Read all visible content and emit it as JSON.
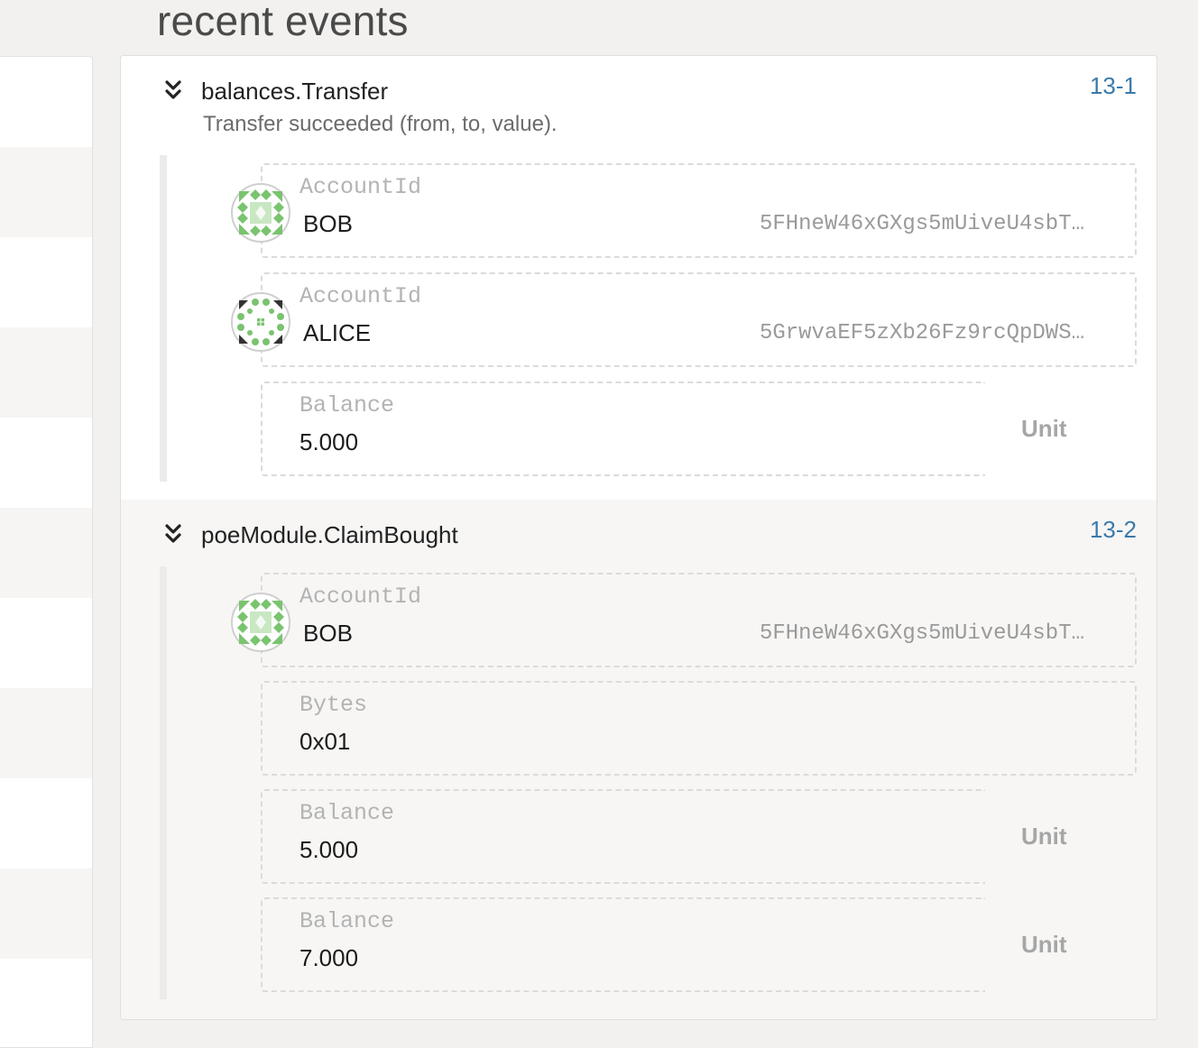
{
  "section": {
    "title": "recent events"
  },
  "events": [
    {
      "method": "balances.Transfer",
      "description": "Transfer succeeded (from, to, value).",
      "id": "13-1",
      "params": [
        {
          "type": "AccountId",
          "name": "BOB",
          "address": "5FHneW46xGXgs5mUiveU4sbT…",
          "icon": "bob-identicon"
        },
        {
          "type": "AccountId",
          "name": "ALICE",
          "address": "5GrwvaEF5zXb26Fz9rcQpDWS…",
          "icon": "alice-identicon"
        },
        {
          "type": "Balance",
          "value": "5.000",
          "unit": "Unit"
        }
      ]
    },
    {
      "method": "poeModule.ClaimBought",
      "id": "13-2",
      "params": [
        {
          "type": "AccountId",
          "name": "BOB",
          "address": "5FHneW46xGXgs5mUiveU4sbT…",
          "icon": "bob-identicon"
        },
        {
          "type": "Bytes",
          "value": "0x01"
        },
        {
          "type": "Balance",
          "value": "5.000",
          "unit": "Unit"
        },
        {
          "type": "Balance",
          "value": "7.000",
          "unit": "Unit"
        }
      ]
    }
  ],
  "colors": {
    "accent": "#3a7aab",
    "identicon_green": "#7ac36f",
    "identicon_dark": "#333333"
  },
  "icons": [
    "chevron-double-down-icon",
    "bob-identicon",
    "alice-identicon"
  ]
}
